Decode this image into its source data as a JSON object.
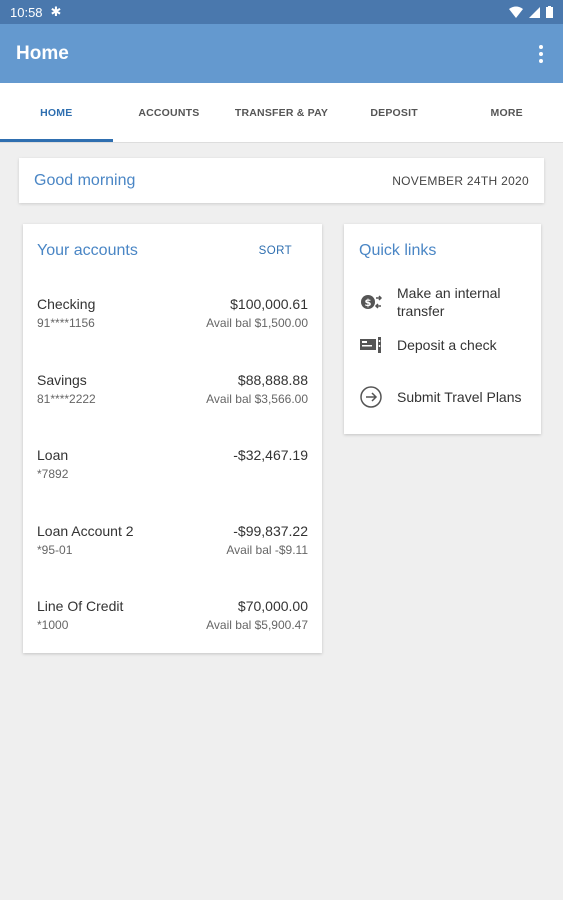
{
  "status": {
    "time": "10:58"
  },
  "appbar": {
    "title": "Home"
  },
  "tabs": [
    "HOME",
    "ACCOUNTS",
    "TRANSFER & PAY",
    "DEPOSIT",
    "MORE"
  ],
  "greeting": {
    "text": "Good morning",
    "date": "NOVEMBER 24TH 2020"
  },
  "accounts": {
    "title": "Your accounts",
    "sort_label": "SORT",
    "items": [
      {
        "name": "Checking",
        "number": "91****1156",
        "amount": "$100,000.61",
        "avail": "Avail bal $1,500.00"
      },
      {
        "name": "Savings",
        "number": "81****2222",
        "amount": "$88,888.88",
        "avail": "Avail bal $3,566.00"
      },
      {
        "name": "Loan",
        "number": "*7892",
        "amount": "-$32,467.19",
        "avail": ""
      },
      {
        "name": "Loan Account 2",
        "number": "*95-01",
        "amount": "-$99,837.22",
        "avail": "Avail bal -$9.11"
      },
      {
        "name": "Line Of Credit",
        "number": "*1000",
        "amount": "$70,000.00",
        "avail": "Avail bal $5,900.47"
      }
    ]
  },
  "quick_links": {
    "title": "Quick links",
    "items": [
      {
        "label": "Make an internal transfer",
        "icon": "transfer-icon"
      },
      {
        "label": "Deposit a check",
        "icon": "check-deposit-icon"
      },
      {
        "label": "Submit Travel Plans",
        "icon": "arrow-circle-icon"
      }
    ]
  }
}
